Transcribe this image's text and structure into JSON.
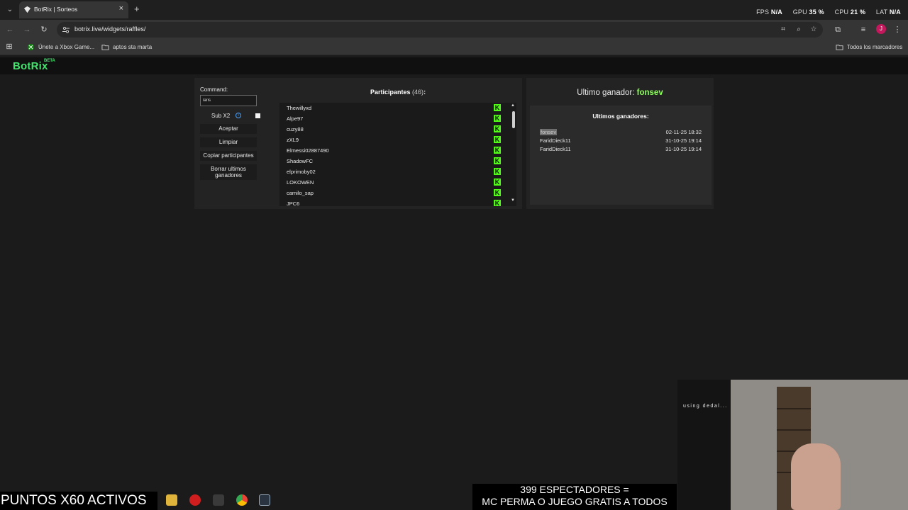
{
  "browser": {
    "tab_title": "BotRix | Sorteos",
    "url": "botrix.live/widgets/raffles/",
    "perf": {
      "fps_label": "FPS",
      "fps_value": "N/A",
      "gpu_label": "GPU",
      "gpu_value": "35 %",
      "cpu_label": "CPU",
      "cpu_value": "21 %",
      "lat_label": "LAT",
      "lat_value": "N/A"
    },
    "bookmarks": [
      {
        "label": "Únete a Xbox Game...",
        "icon": "xbox-icon"
      },
      {
        "label": "aptos sta marta",
        "icon": "folder-icon"
      }
    ],
    "all_bookmarks_label": "Todos los marcadores",
    "profile_initial": "J"
  },
  "app": {
    "logo": "BotRix",
    "beta": "BETA"
  },
  "controls": {
    "command_label": "Command:",
    "command_value": "laris",
    "sub_label": "Sub X2",
    "buttons": {
      "accept": "Aceptar",
      "clear": "Limpiar",
      "copy": "Copiar participantes",
      "delete_winners": "Borrar ultimos ganadores"
    }
  },
  "participants": {
    "title": "Participantes",
    "count": "(46)",
    "colon": ":",
    "list": [
      "Thewillyxd",
      "Alpe97",
      "cuzy88",
      "zXL9",
      "Elmessi02887490",
      "ShadowFC",
      "elprimoby02",
      "LOKOWEN",
      "camilo_sap",
      "JPC6"
    ],
    "platform_icon": "kick-icon"
  },
  "winners": {
    "last_label": "Ultimo ganador:",
    "last_name": "fonsev",
    "recent_title": "Ultimos ganadores:",
    "recent": [
      {
        "name": "fonsev",
        "date": "02-11-25 18:32"
      },
      {
        "name": "FaridDieck11",
        "date": "31-10-25 19:14"
      },
      {
        "name": "FaridDieck11",
        "date": "31-10-25 19:14"
      }
    ]
  },
  "stream_overlay": {
    "points_text": "PUNTOS X60 ACTIVOS",
    "viewers_line1": "399 ESPECTADORES =",
    "viewers_line2": "MC PERMA O JUEGO GRATIS A TODOS",
    "cam_text": "using dedal..."
  },
  "colors": {
    "brand_green": "#44e26e",
    "kick_green": "#53fc18",
    "winner_green": "#8dff5c",
    "background": "#1b1b1b",
    "panel": "#232323"
  }
}
